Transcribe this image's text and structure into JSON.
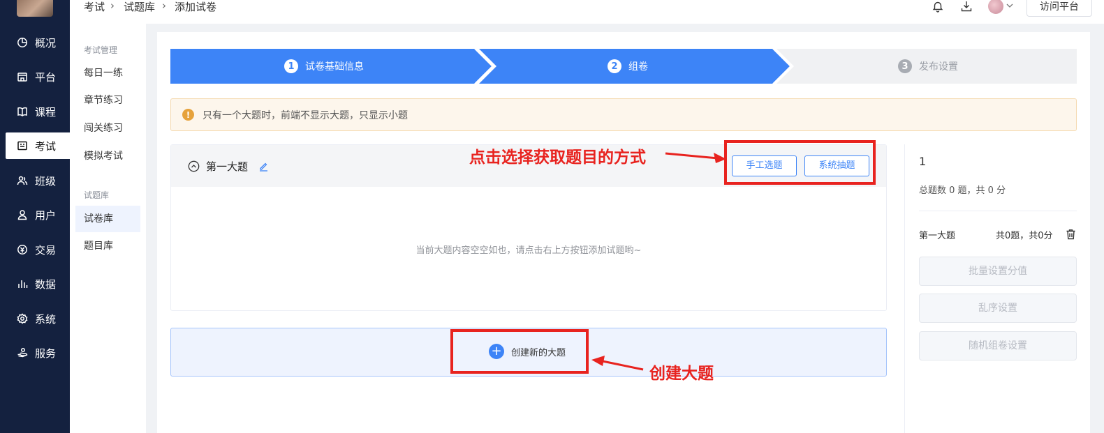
{
  "sidebar": {
    "items": [
      {
        "label": "概况",
        "icon": "pie-chart-icon"
      },
      {
        "label": "平台",
        "icon": "storefront-icon"
      },
      {
        "label": "课程",
        "icon": "book-icon"
      },
      {
        "label": "考试",
        "icon": "exam-icon"
      },
      {
        "label": "班级",
        "icon": "class-icon"
      },
      {
        "label": "用户",
        "icon": "user-icon"
      },
      {
        "label": "交易",
        "icon": "currency-icon"
      },
      {
        "label": "数据",
        "icon": "bar-chart-icon"
      },
      {
        "label": "系统",
        "icon": "gear-icon"
      },
      {
        "label": "服务",
        "icon": "service-icon"
      }
    ],
    "active": "考试"
  },
  "subnav": {
    "group1": "考试管理",
    "group1_items": [
      "每日一练",
      "章节练习",
      "闯关练习",
      "模拟考试"
    ],
    "group2": "试题库",
    "group2_items": [
      "试卷库",
      "题目库"
    ],
    "active": "试卷库"
  },
  "header": {
    "breadcrumb": [
      "考试",
      "试题库",
      "添加试卷"
    ],
    "visit_label": "访问平台"
  },
  "steps": [
    {
      "num": "1",
      "label": "试卷基础信息",
      "state": "done"
    },
    {
      "num": "2",
      "label": "组卷",
      "state": "current"
    },
    {
      "num": "3",
      "label": "发布设置",
      "state": "pending"
    }
  ],
  "alert": {
    "text": "只有一个大题时，前端不显示大题，只显示小题"
  },
  "section": {
    "title": "第一大题",
    "manual_btn": "手工选题",
    "system_btn": "系统抽题",
    "empty_text": "当前大题内容空空如也，请点击右上方按钮添加试题哟~"
  },
  "create": {
    "label": "创建新的大题"
  },
  "right_panel": {
    "count": "1",
    "summary": "总题数 0 题，共 0 分",
    "row_title": "第一大题",
    "row_value": "共0题，共0分",
    "buttons": [
      "批量设置分值",
      "乱序设置",
      "随机组卷设置"
    ]
  },
  "annotations": {
    "top": "点击选择获取题目的方式",
    "bottom": "创建大题"
  },
  "colors": {
    "primary": "#3d84f7",
    "sidebar": "#14213f",
    "annotation": "#e8231f",
    "alert_bg": "#fdf6ec",
    "warn": "#e6a23c"
  }
}
